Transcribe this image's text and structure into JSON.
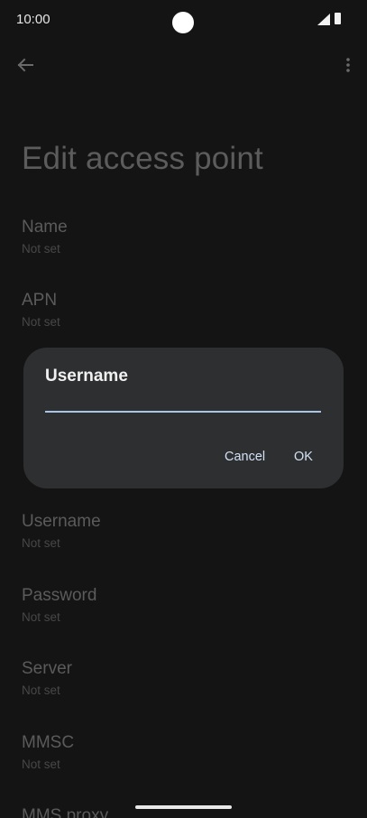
{
  "status_bar": {
    "time": "10:00"
  },
  "page": {
    "title": "Edit access point"
  },
  "preferences": [
    {
      "title": "Name",
      "summary": "Not set"
    },
    {
      "title": "APN",
      "summary": "Not set"
    },
    {
      "title": "",
      "summary": ""
    },
    {
      "title": "",
      "summary": ""
    },
    {
      "title": "Username",
      "summary": "Not set"
    },
    {
      "title": "Password",
      "summary": "Not set"
    },
    {
      "title": "Server",
      "summary": "Not set"
    },
    {
      "title": "MMSC",
      "summary": "Not set"
    },
    {
      "title": "MMS proxy",
      "summary": ""
    }
  ],
  "dialog": {
    "title": "Username",
    "input_value": "",
    "cancel_label": "Cancel",
    "ok_label": "OK"
  },
  "icons": {
    "back": "arrow-back-icon",
    "more": "more-vert-icon",
    "signal": "signal-icon",
    "battery": "battery-icon"
  }
}
